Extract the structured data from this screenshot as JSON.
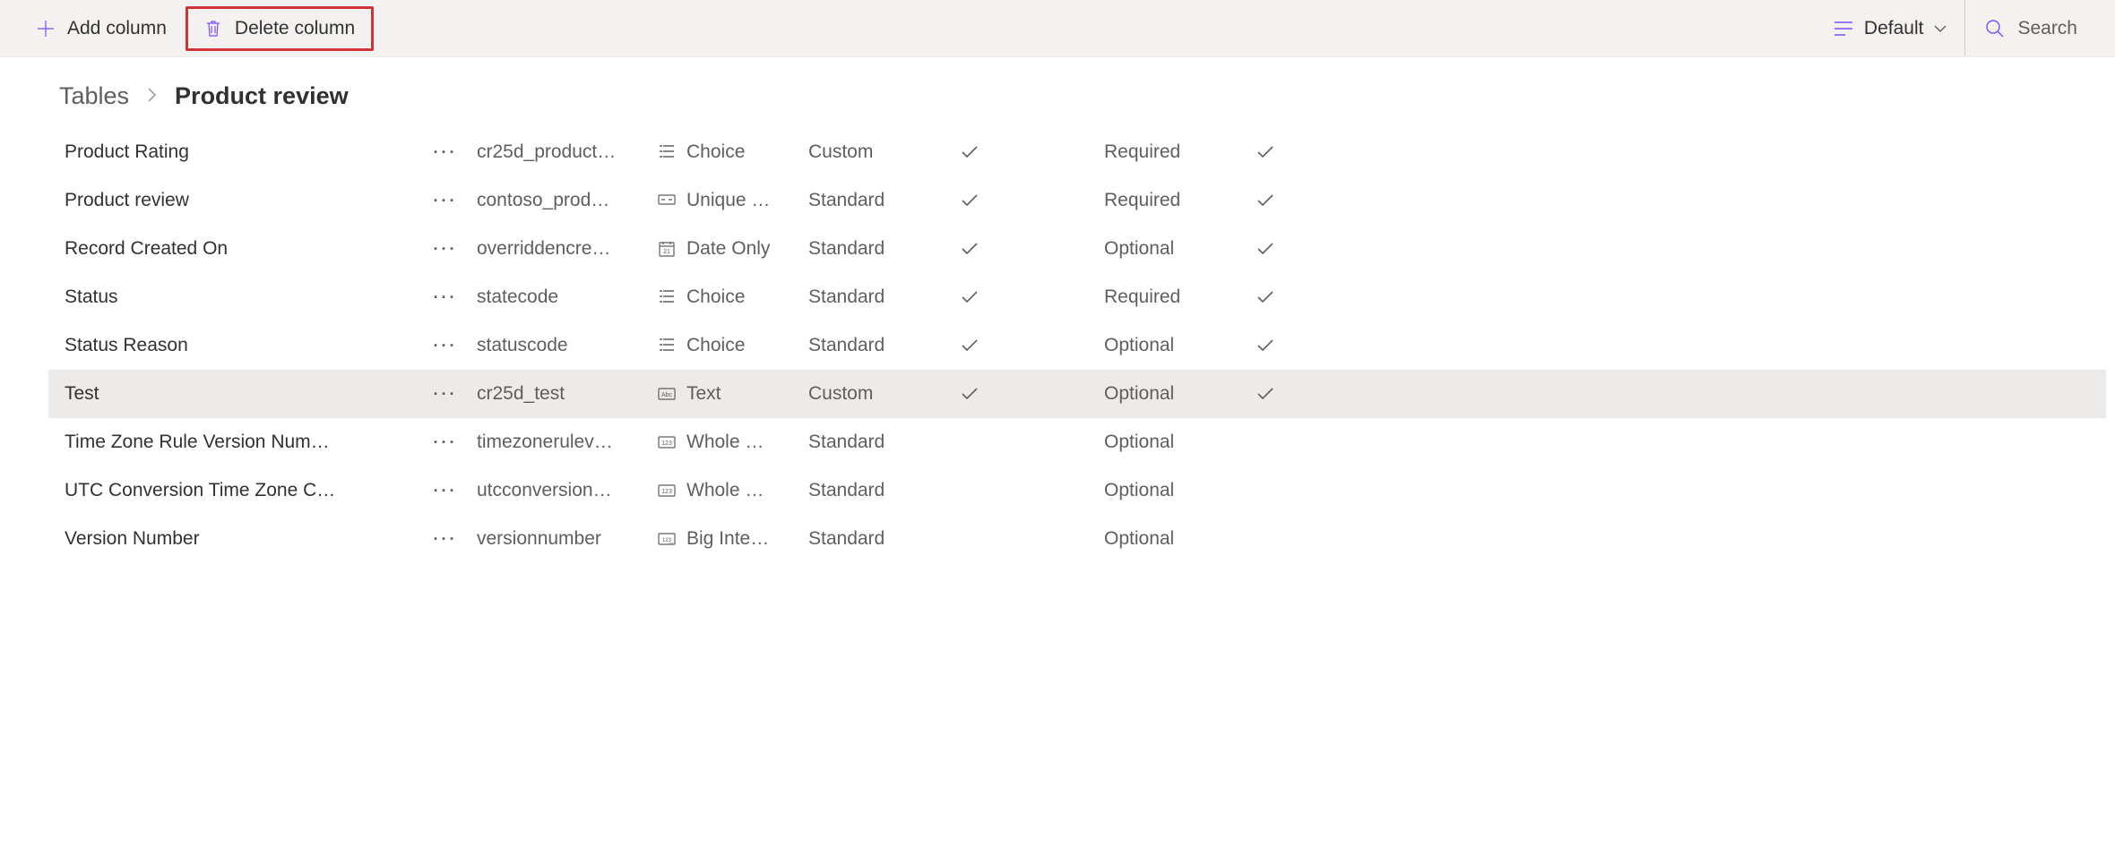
{
  "toolbar": {
    "add_column": "Add column",
    "delete_column": "Delete column",
    "view_label": "Default",
    "search_label": "Search"
  },
  "breadcrumb": {
    "parent": "Tables",
    "current": "Product review"
  },
  "rows": [
    {
      "name": "Product Rating",
      "schema": "cr25d_product…",
      "type_icon": "choice",
      "type": "Choice",
      "managed": "Custom",
      "check1": true,
      "required": "Required",
      "check2": true,
      "selected": false
    },
    {
      "name": "Product review",
      "schema": "contoso_prod…",
      "type_icon": "unique",
      "type": "Unique …",
      "managed": "Standard",
      "check1": true,
      "required": "Required",
      "check2": true,
      "selected": false
    },
    {
      "name": "Record Created On",
      "schema": "overriddencre…",
      "type_icon": "date",
      "type": "Date Only",
      "managed": "Standard",
      "check1": true,
      "required": "Optional",
      "check2": true,
      "selected": false
    },
    {
      "name": "Status",
      "schema": "statecode",
      "type_icon": "choice",
      "type": "Choice",
      "managed": "Standard",
      "check1": true,
      "required": "Required",
      "check2": true,
      "selected": false
    },
    {
      "name": "Status Reason",
      "schema": "statuscode",
      "type_icon": "choice",
      "type": "Choice",
      "managed": "Standard",
      "check1": true,
      "required": "Optional",
      "check2": true,
      "selected": false
    },
    {
      "name": "Test",
      "schema": "cr25d_test",
      "type_icon": "text",
      "type": "Text",
      "managed": "Custom",
      "check1": true,
      "required": "Optional",
      "check2": true,
      "selected": true
    },
    {
      "name": "Time Zone Rule Version Num…",
      "schema": "timezonerulev…",
      "type_icon": "whole",
      "type": "Whole …",
      "managed": "Standard",
      "check1": false,
      "required": "Optional",
      "check2": false,
      "selected": false
    },
    {
      "name": "UTC Conversion Time Zone C…",
      "schema": "utcconversion…",
      "type_icon": "whole",
      "type": "Whole …",
      "managed": "Standard",
      "check1": false,
      "required": "Optional",
      "check2": false,
      "selected": false
    },
    {
      "name": "Version Number",
      "schema": "versionnumber",
      "type_icon": "bigint",
      "type": "Big Inte…",
      "managed": "Standard",
      "check1": false,
      "required": "Optional",
      "check2": false,
      "selected": false
    }
  ]
}
